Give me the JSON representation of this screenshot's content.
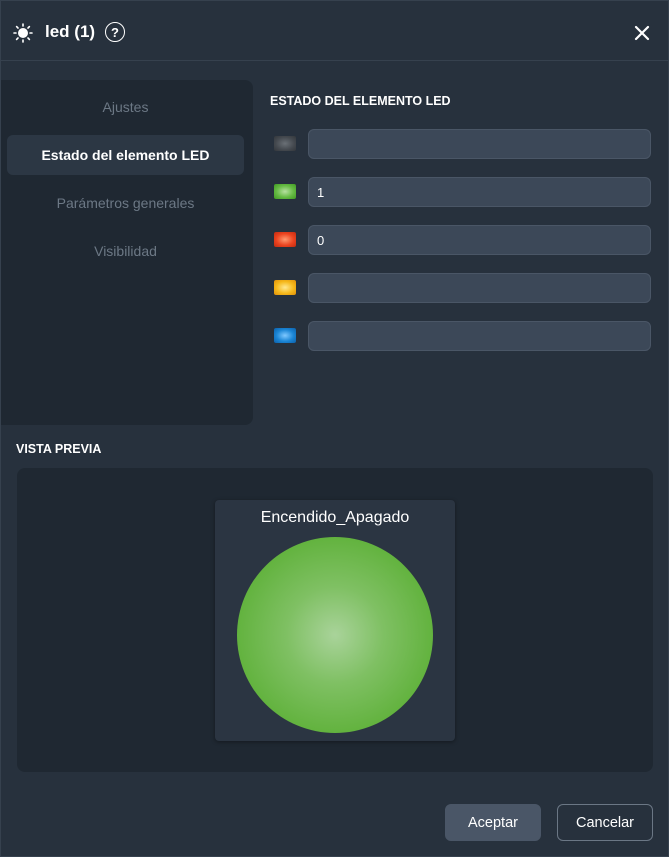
{
  "header": {
    "title": "led (1)",
    "help_symbol": "?",
    "icons": {
      "app": "sun-icon",
      "help": "help-circle-icon",
      "close": "close-icon"
    }
  },
  "sidebar": {
    "items": [
      {
        "label": "Ajustes",
        "active": false
      },
      {
        "label": "Estado del elemento LED",
        "active": true
      },
      {
        "label": "Parámetros generales",
        "active": false
      },
      {
        "label": "Visibilidad",
        "active": false
      }
    ]
  },
  "led_state": {
    "title": "ESTADO DEL ELEMENTO LED",
    "rows": [
      {
        "color_name": "gray",
        "color": "#4a4f55",
        "value": ""
      },
      {
        "color_name": "green",
        "color": "#5cb83a",
        "value": "1"
      },
      {
        "color_name": "red",
        "color": "#e23a1c",
        "value": "0"
      },
      {
        "color_name": "yellow",
        "color": "#f2b21b",
        "value": ""
      },
      {
        "color_name": "blue",
        "color": "#1a84d4",
        "value": ""
      }
    ]
  },
  "preview": {
    "title": "VISTA PREVIA",
    "label": "Encendido_Apagado",
    "led_color": "#5fb13a"
  },
  "footer": {
    "accept_label": "Aceptar",
    "cancel_label": "Cancelar"
  }
}
